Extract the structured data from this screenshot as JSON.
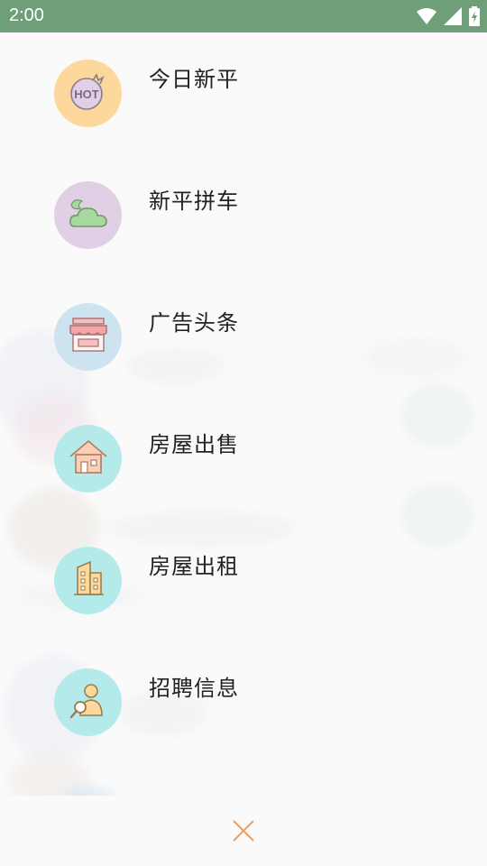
{
  "status_bar": {
    "time": "2:00",
    "icons": [
      "wifi-icon",
      "signal-icon",
      "battery-charging-icon"
    ]
  },
  "menu": {
    "items": [
      {
        "label": "今日新平",
        "icon": "hot-badge-icon",
        "circle_color": "#fcd89c"
      },
      {
        "label": "新平拼车",
        "icon": "cloud-icon",
        "circle_color": "#e1cfe6"
      },
      {
        "label": "广告头条",
        "icon": "storefront-icon",
        "circle_color": "#cde3f0"
      },
      {
        "label": "房屋出售",
        "icon": "house-icon",
        "circle_color": "#b5eaea"
      },
      {
        "label": "房屋出租",
        "icon": "building-icon",
        "circle_color": "#b5eaea"
      },
      {
        "label": "招聘信息",
        "icon": "recruiter-search-icon",
        "circle_color": "#b5eaea"
      }
    ]
  },
  "bottom_bar": {
    "close_icon": "close-icon",
    "accent": "#f0a060"
  }
}
